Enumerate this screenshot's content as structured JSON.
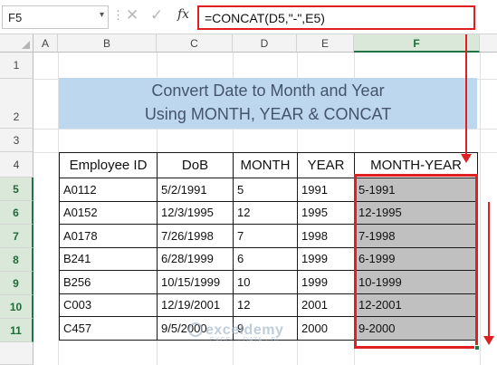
{
  "formula_bar": {
    "name_box": "F5",
    "name_box_arrow": "▾",
    "separator": "⋮",
    "cancel_icon": "✕",
    "enter_icon": "✓",
    "fx_label": "fx",
    "formula": "=CONCAT(D5,\"-\",E5)"
  },
  "columns": [
    "A",
    "B",
    "C",
    "D",
    "E",
    "F"
  ],
  "rows": [
    "1",
    "2",
    "3",
    "4",
    "5",
    "6",
    "7",
    "8",
    "9",
    "10",
    "11"
  ],
  "banner": {
    "line1": "Convert Date to Month and Year",
    "line2": "Using MONTH, YEAR & CONCAT"
  },
  "table": {
    "headers": [
      "Employee ID",
      "DoB",
      "MONTH",
      "YEAR",
      "MONTH-YEAR"
    ],
    "rows": [
      [
        "A0112",
        "5/2/1991",
        "5",
        "1991",
        "5-1991"
      ],
      [
        "A0152",
        "12/3/1995",
        "12",
        "1995",
        "12-1995"
      ],
      [
        "A0178",
        "7/26/1998",
        "7",
        "1998",
        "7-1998"
      ],
      [
        "B241",
        "6/28/1999",
        "6",
        "1999",
        "6-1999"
      ],
      [
        "B256",
        "10/15/1999",
        "10",
        "1999",
        "10-1999"
      ],
      [
        "C003",
        "12/19/2001",
        "12",
        "2001",
        "12-2001"
      ],
      [
        "C457",
        "9/5/2000",
        "9",
        "2000",
        "9-2000"
      ]
    ]
  },
  "watermark": {
    "name": "exceldemy",
    "tagline": "EXCEL · DATA · BI"
  },
  "colors": {
    "accent": "#e02020",
    "excel_green": "#217346",
    "banner_fill": "#bdd7ee",
    "result_fill": "#c0c0c0"
  }
}
